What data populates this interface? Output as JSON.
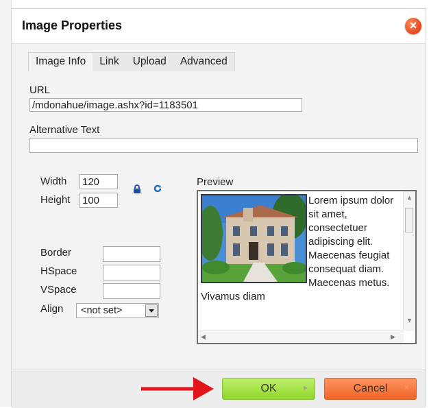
{
  "dialog": {
    "title": "Image Properties",
    "close_icon": "close-icon"
  },
  "tabs": [
    {
      "label": "Image Info",
      "active": true
    },
    {
      "label": "Link",
      "active": false
    },
    {
      "label": "Upload",
      "active": false
    },
    {
      "label": "Advanced",
      "active": false
    }
  ],
  "form": {
    "url_label": "URL",
    "url_value": "/mdonahue/image.ashx?id=1183501",
    "alt_label": "Alternative Text",
    "alt_value": "",
    "width_label": "Width",
    "width_value": "120",
    "height_label": "Height",
    "height_value": "100",
    "border_label": "Border",
    "border_value": "",
    "hspace_label": "HSpace",
    "hspace_value": "",
    "vspace_label": "VSpace",
    "vspace_value": "",
    "align_label": "Align",
    "align_value": "<not set>",
    "lock_icon": "lock-icon",
    "reset_icon": "reset-size-icon"
  },
  "preview": {
    "label": "Preview",
    "text": "Lorem ipsum dolor sit amet, consectetuer adipiscing elit. Maecenas feugiat consequat diam. Maecenas metus. Vivamus diam"
  },
  "footer": {
    "ok_label": "OK",
    "cancel_label": "Cancel",
    "ok_glyph": "▸",
    "cancel_glyph": "×"
  },
  "colors": {
    "ok": "#9be03a",
    "cancel": "#f27432",
    "close": "#ef5a2b",
    "arrow": "#e1151a"
  }
}
